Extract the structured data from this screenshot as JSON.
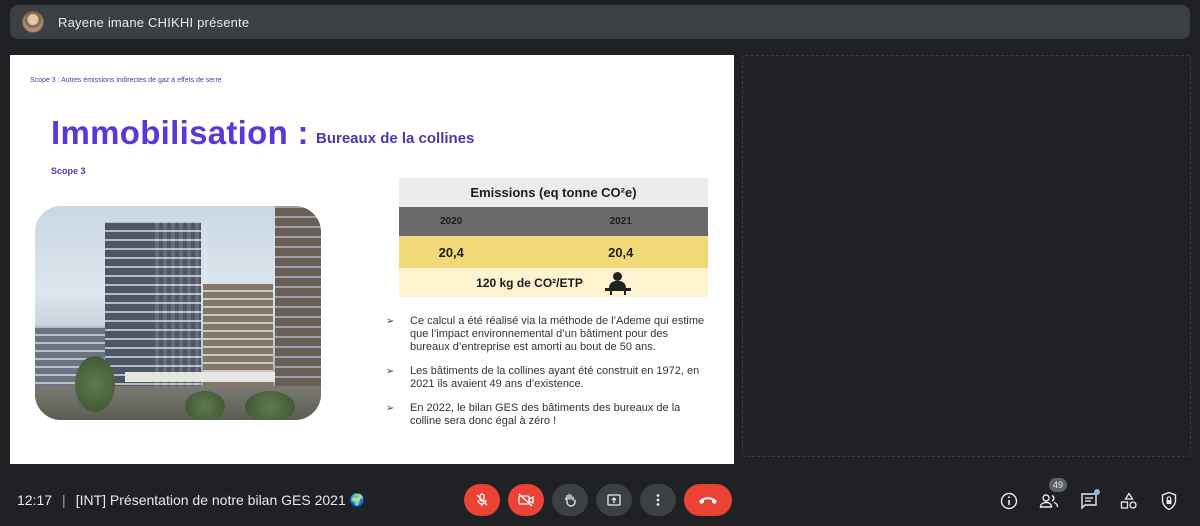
{
  "presenter": {
    "name": "Rayene imane CHIKHI présente"
  },
  "slide": {
    "breadcrumb": "Scope 3 : Autres émissions indirectes de gaz à effets de serre",
    "title": "Immobilisation :",
    "subtitle": "Bureaux de la collines",
    "scope_label": "Scope 3",
    "table": {
      "header": "Emissions (eq tonne CO²e)",
      "years": [
        "2020",
        "2021"
      ],
      "values": [
        "20,4",
        "20,4"
      ],
      "ratio": "120 kg de CO²/ETP"
    },
    "bullets": [
      "Ce calcul a été réalisé via la méthode de l’Ademe qui estime que l’impact environnemental d’un bâtiment pour des bureaux d’entreprise est amorti au bout de 50 ans.",
      "Les bâtiments de la collines ayant été construit en 1972, en 2021 ils avaient 49 ans d’existence.",
      "En 2022, le bilan GES des bâtiments des bureaux de la colline sera donc égal à zéro !"
    ],
    "bullet_marker": "➢"
  },
  "meeting": {
    "time": "12:17",
    "separator": "|",
    "title": "[INT] Présentation de notre bilan GES 2021",
    "globe": "🌍",
    "participant_count": "49"
  },
  "colors": {
    "accent_purple": "#5b36d9",
    "table_yellow": "#f1d97a",
    "hangup_red": "#ea4335"
  }
}
